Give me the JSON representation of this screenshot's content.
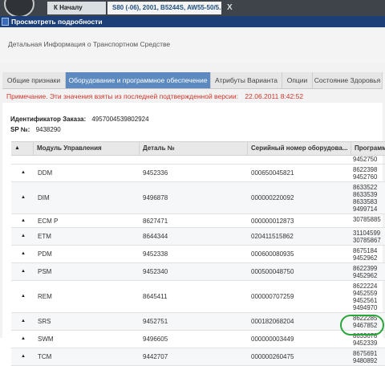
{
  "tabbar": {
    "home_label": "К Началу",
    "vehicle_label": "S80 (-06), 2001, B5244S, AW55-50/5...",
    "close_label": "X"
  },
  "window": {
    "title": "Просмотреть подробности"
  },
  "section_title": "Детальная Информация о Транспортном Средстве",
  "tabs": [
    "Общие признаки",
    "Оборудование и программное обеспечение",
    "Атрибуты Варианта",
    "Опции",
    "Состояние Здоровья"
  ],
  "note": {
    "label": "Примечание. Эти значения взяты из последней подтвержденной версии:",
    "date": "22.06.2011 8:42:52"
  },
  "order": {
    "label": "Идентификатор Заказа:",
    "value": "4957004539802924"
  },
  "sp": {
    "label": "SP №:",
    "value": "9438290"
  },
  "grid": {
    "headers": [
      "Модуль Управления",
      "Деталь №",
      "Серийный номер оборудова...",
      "Программ"
    ],
    "top_partial": [
      "9452750"
    ],
    "rows": [
      {
        "module": "DDM",
        "part": "9452336",
        "serial": "000650045821",
        "programs": [
          "8622398",
          "9452760"
        ]
      },
      {
        "module": "DIM",
        "part": "9496878",
        "serial": "000000220092",
        "programs": [
          "8633522",
          "8633539",
          "8633583",
          "9499714"
        ]
      },
      {
        "module": "ECM P",
        "part": "8627471",
        "serial": "000000012873",
        "programs": [
          "30785885"
        ]
      },
      {
        "module": "ETM",
        "part": "8644344",
        "serial": "020411515862",
        "programs": [
          "31104599",
          "30785867"
        ]
      },
      {
        "module": "PDM",
        "part": "9452338",
        "serial": "000600080935",
        "programs": [
          "8675184",
          "9452962"
        ]
      },
      {
        "module": "PSM",
        "part": "9452340",
        "serial": "000500048750",
        "programs": [
          "8622399",
          "9452962"
        ]
      },
      {
        "module": "REM",
        "part": "8645411",
        "serial": "000000707259",
        "programs": [
          "8622224",
          "9452559",
          "9452561",
          "9494970"
        ]
      },
      {
        "module": "SRS",
        "part": "9452751",
        "serial": "000182068204",
        "programs": [
          "8622285",
          "9467852"
        ]
      },
      {
        "module": "SWM",
        "part": "9496605",
        "serial": "000000003449",
        "programs": [
          "8633678",
          "9452339"
        ]
      },
      {
        "module": "TCM",
        "part": "9442707",
        "serial": "000000260475",
        "programs": [
          "8675691",
          "9480892"
        ]
      }
    ]
  }
}
